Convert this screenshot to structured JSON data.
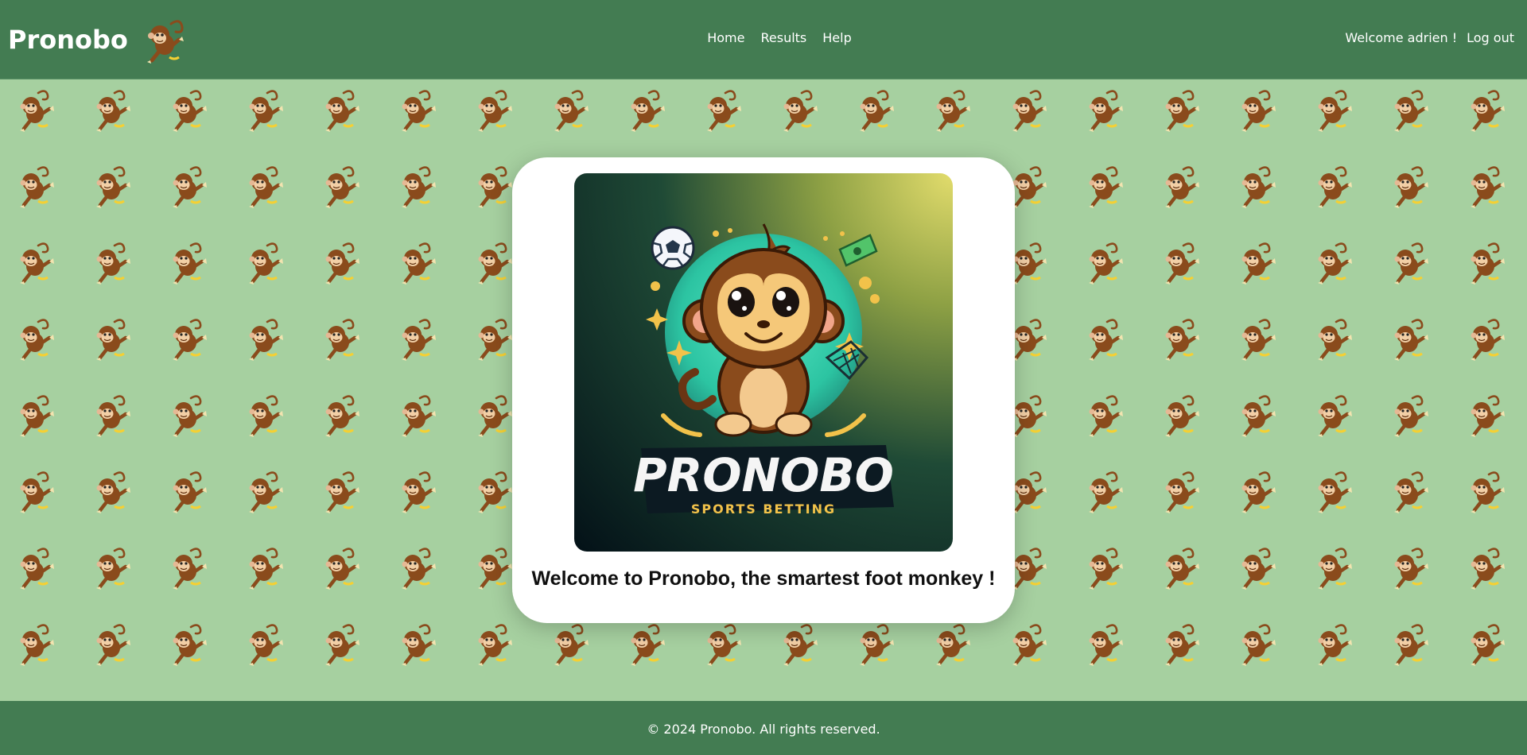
{
  "header": {
    "brand": "Pronobo",
    "nav": [
      {
        "label": "Home"
      },
      {
        "label": "Results"
      },
      {
        "label": "Help"
      }
    ],
    "welcome_text": "Welcome adrien !",
    "logout_label": "Log out"
  },
  "main": {
    "hero_logo": {
      "title": "PRONOBO",
      "subtitle": "SPORTS BETTING"
    },
    "welcome_message": "Welcome to Pronobo, the smartest foot monkey !"
  },
  "footer": {
    "text": "© 2024 Pronobo. All rights reserved."
  },
  "icons": [
    "monkey-logo-icon",
    "monkey-pattern-icon",
    "soccer-ball-icon",
    "money-bill-icon"
  ],
  "colors": {
    "header_bg": "#437c52",
    "page_bg": "#a6d0a0",
    "card_bg": "#ffffff",
    "text_light": "#ffffff",
    "accent_gold": "#f1c84b"
  }
}
